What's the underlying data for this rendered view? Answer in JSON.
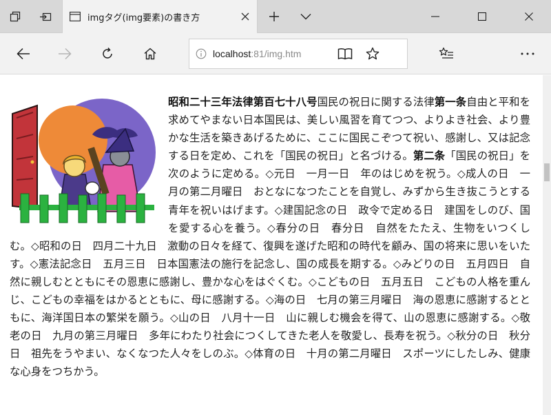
{
  "tab": {
    "title": "imgタグ(img要素)の書き方"
  },
  "address_bar": {
    "host": "localhost",
    "rest": ":81/img.htm"
  },
  "icons": {
    "tab_actions": "tab-actions-icon",
    "set_aside": "set-aside-tabs-icon",
    "favicon": "page-favicon-icon",
    "close": "close-icon",
    "new_tab": "plus-icon",
    "tab_preview": "chevron-down-icon",
    "back": "arrow-left-icon",
    "forward": "arrow-right-icon",
    "refresh": "refresh-icon",
    "home": "home-icon",
    "site_info": "info-icon",
    "reading_view": "book-icon",
    "favorite": "star-icon",
    "favorites_hub": "favorites-list-icon",
    "more": "more-icon"
  },
  "colors": {
    "tabstrip": "#d8d8d8",
    "toolbar": "#f2f2f2",
    "sky": "#7b65c8",
    "moon": "#ee8a38",
    "door": "#c2343a",
    "fence": "#2bb240",
    "robe": "#e65ca6"
  },
  "article": {
    "title_bold": "昭和二十三年法律第百七十八号",
    "title_normal": "国民の祝日に関する法律",
    "art1_label": "第一条",
    "art1_text": "自由と平和を求めてやまない日本国民は、美しい風習を育てつつ、よりよき社会、より豊かな生活を築きあげるために、ここに国民こぞつて祝い、感謝し、又は記念する日を定め、これを「国民の祝日」と名づける。",
    "art2_label": "第二条",
    "art2_text": "「国民の祝日」を次のように定める。◇元日　一月一日　年のはじめを祝う。◇成人の日　一月の第二月曜日　おとなになつたことを自覚し、みずから生き抜こうとする青年を祝いはげます。◇建国記念の日　政令で定める日　建国をしのび、国を愛する心を養う。◇春分の日　春分日　自然をたたえ、生物をいつくしむ。◇昭和の日　四月二十九日　激動の日々を経て、復興を遂げた昭和の時代を顧み、国の将来に思いをいたす。◇憲法記念日　五月三日　日本国憲法の施行を記念し、国の成長を期する。◇みどりの日　五月四日　自然に親しむとともにその恩恵に感謝し、豊かな心をはぐくむ。◇こどもの日　五月五日　こどもの人格を重んじ、こどもの幸福をはかるとともに、母に感謝する。◇海の日　七月の第三月曜日　海の恩恵に感謝するとともに、海洋国日本の繁栄を願う。◇山の日　八月十一日　山に親しむ機会を得て、山の恩恵に感謝する。◇敬老の日　九月の第三月曜日　多年にわたり社会につくしてきた老人を敬愛し、長寿を祝う。◇秋分の日　秋分日　祖先をうやまい、なくなつた人々をしのぶ。◇体育の日　十月の第二月曜日　スポーツにしたしみ、健康な心身をつちかう。"
  }
}
